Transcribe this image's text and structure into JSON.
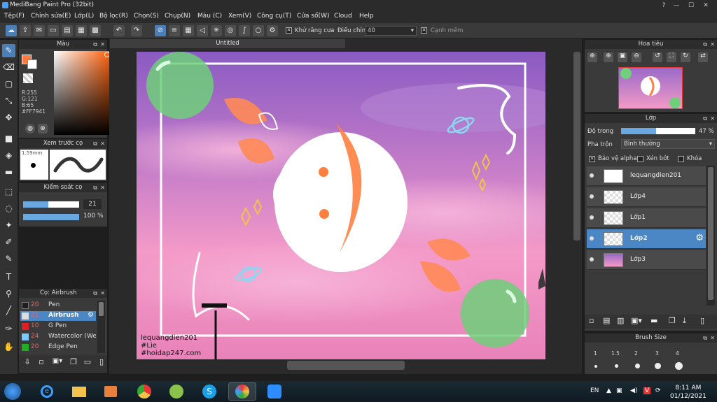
{
  "window": {
    "title": "MediBang Paint Pro (32bit)"
  },
  "menu": [
    "Tệp(F)",
    "Chỉnh sửa(E)",
    "Lớp(L)",
    "Bộ lọc(R)",
    "Chọn(S)",
    "Chụp(N)",
    "Màu (C)",
    "Xem(V)",
    "Công cụ(T)",
    "Cửa sổ(W)",
    "Cloud",
    "Help"
  ],
  "toolbar": {
    "antialias_label": "Khử răng cưa",
    "adjust_label": "Điều chỉnh",
    "adjust_value": "40",
    "sharp_edge_label": "Cạnh mềm"
  },
  "color_panel": {
    "title": "Màu",
    "r": "R:255",
    "g": "G:121",
    "b": "B:65",
    "hex": "#FF7941",
    "primary": "#FF7941"
  },
  "brush_preview": {
    "title": "Xem trước cọ",
    "size": "1.59mm"
  },
  "brush_control": {
    "title": "Kiểm soát cọ",
    "size_value": "21",
    "opacity_value": "100 %"
  },
  "brush_list": {
    "title": "Cọ: Airbrush",
    "items": [
      {
        "num": "20",
        "name": "Pen",
        "color": "#1e1e1e"
      },
      {
        "num": "21",
        "name": "Airbrush",
        "color": "#dddddd"
      },
      {
        "num": "10",
        "name": "G Pen",
        "color": "#e02020"
      },
      {
        "num": "24",
        "name": "Watercolor (Wet)",
        "color": "#7ac8ff"
      },
      {
        "num": "20",
        "name": "Edge Pen",
        "color": "#20b020"
      }
    ]
  },
  "canvas": {
    "tab_title": "Untitled"
  },
  "watermark": {
    "line1": "lequangdien201",
    "line2": "#Lie",
    "line3": "#hoidap247.com"
  },
  "navigator": {
    "title": "Hoa tiêu"
  },
  "layers": {
    "title": "Lớp",
    "opacity_label": "Độ trong",
    "opacity_value": "47 %",
    "blend_label": "Pha trộn",
    "blend_value": "Bình thường",
    "protect_alpha": "Bảo vệ alpha",
    "clipping": "Xén bớt",
    "lock": "Khóa",
    "items": [
      {
        "name": "lequangdien201"
      },
      {
        "name": "Lớp4"
      },
      {
        "name": "Lớp1"
      },
      {
        "name": "Lớp2"
      },
      {
        "name": "Lớp3"
      }
    ]
  },
  "brush_size": {
    "title": "Brush Size",
    "sizes": [
      "1",
      "1.5",
      "2",
      "3",
      "4"
    ]
  },
  "taskbar": {
    "lang": "EN",
    "time": "8:11 AM",
    "date": "01/12/2021"
  }
}
